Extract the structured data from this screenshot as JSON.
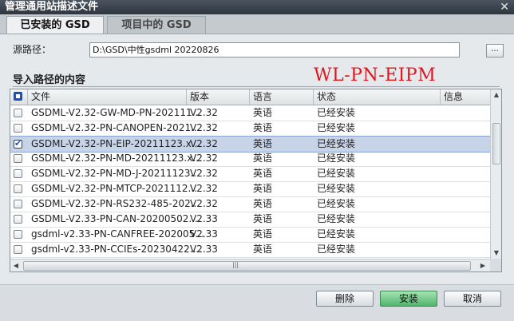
{
  "window": {
    "title": "管理通用站描述文件",
    "close_glyph": "✕"
  },
  "tabs": [
    {
      "label": "已安装的 GSD"
    },
    {
      "label": "项目中的 GSD"
    }
  ],
  "source": {
    "label": "源路径：",
    "value": "D:\\GSD\\中性gsdml 20220826",
    "browse_label": "..."
  },
  "section_title": "导入路径的内容",
  "overlay_text": "WL-PN-EIPM",
  "table": {
    "columns": [
      "文件",
      "版本",
      "语言",
      "状态",
      "信息"
    ],
    "rows": [
      {
        "checked": false,
        "file": "GSDML-V2.32-GW-MD-PN-202111...",
        "version": "V2.32",
        "language": "英语",
        "status": "已经安装"
      },
      {
        "checked": false,
        "file": "GSDML-V2.32-PN-CANOPEN-2021...",
        "version": "V2.32",
        "language": "英语",
        "status": "已经安装"
      },
      {
        "checked": true,
        "file": "GSDML-V2.32-PN-EIP-20211123.x...",
        "version": "V2.32",
        "language": "英语",
        "status": "已经安装"
      },
      {
        "checked": false,
        "file": "GSDML-V2.32-PN-MD-20211123.x...",
        "version": "V2.32",
        "language": "英语",
        "status": "已经安装"
      },
      {
        "checked": false,
        "file": "GSDML-V2.32-PN-MD-J-20211123...",
        "version": "V2.32",
        "language": "英语",
        "status": "已经安装"
      },
      {
        "checked": false,
        "file": "GSDML-V2.32-PN-MTCP-2021112...",
        "version": "V2.32",
        "language": "英语",
        "status": "已经安装"
      },
      {
        "checked": false,
        "file": "GSDML-V2.32-PN-RS232-485-202...",
        "version": "V2.32",
        "language": "英语",
        "status": "已经安装"
      },
      {
        "checked": false,
        "file": "GSDML-V2.33-PN-CAN-20200502....",
        "version": "V2.33",
        "language": "英语",
        "status": "已经安装"
      },
      {
        "checked": false,
        "file": "gsdml-v2.33-PN-CANFREE-202005...",
        "version": "V2.33",
        "language": "英语",
        "status": "已经安装"
      },
      {
        "checked": false,
        "file": "gsdml-v2.33-PN-CCIEs-20230422....",
        "version": "V2.33",
        "language": "英语",
        "status": "已经安装"
      }
    ],
    "selected_row": 2
  },
  "scrollbars": {
    "up_icon": "▲",
    "down_icon": "▼",
    "left_icon": "◀",
    "right_icon": "▶",
    "grip_icon": "|||"
  },
  "buttons": {
    "delete": "删除",
    "install": "安装",
    "cancel": "取消"
  },
  "colors": {
    "install_button": "#4fb56b",
    "overlay_text": "#e1141c",
    "selected_row": "#c7d3e7"
  }
}
